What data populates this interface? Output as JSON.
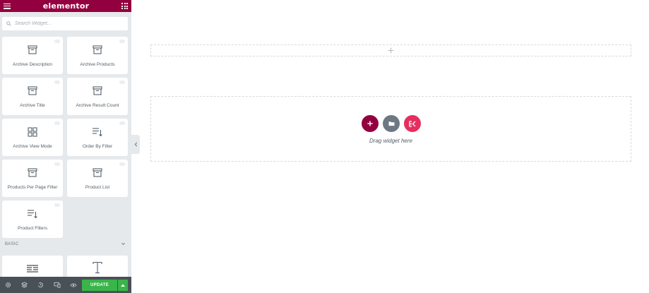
{
  "app": {
    "brand": "elementor"
  },
  "search": {
    "placeholder": "Search Widget..."
  },
  "widgets": [
    {
      "label": "Archive Description",
      "icon": "archive-icon"
    },
    {
      "label": "Archive Products",
      "icon": "archive-icon"
    },
    {
      "label": "Archive Title",
      "icon": "archive-icon"
    },
    {
      "label": "Archive Result Count",
      "icon": "archive-icon"
    },
    {
      "label": "Archive View Mode",
      "icon": "grid-icon"
    },
    {
      "label": "Order By Filter",
      "icon": "sort-list-icon"
    },
    {
      "label": "Products Per Page Filter",
      "icon": "archive-icon"
    },
    {
      "label": "Product List",
      "icon": "archive-icon"
    },
    {
      "label": "Product Filters",
      "icon": "sort-list-icon"
    }
  ],
  "basic_section": {
    "title": "BASIC",
    "widgets": [
      {
        "icon": "inner-section-icon"
      },
      {
        "icon": "heading-icon"
      }
    ]
  },
  "footer": {
    "icons": [
      "settings-icon",
      "navigator-layers-icon",
      "history-icon",
      "responsive-icon",
      "preview-eye-icon"
    ],
    "update_label": "UPDATE"
  },
  "canvas": {
    "drag_text": "Drag widget here"
  },
  "colors": {
    "brand": "#93003f",
    "add_button": "#93003f",
    "template_button": "#6d7882",
    "elementskit_button": "#e52f5f",
    "update_green": "#39b54a",
    "footer_bg": "#495157",
    "panel_bg": "#e6e9ec"
  }
}
